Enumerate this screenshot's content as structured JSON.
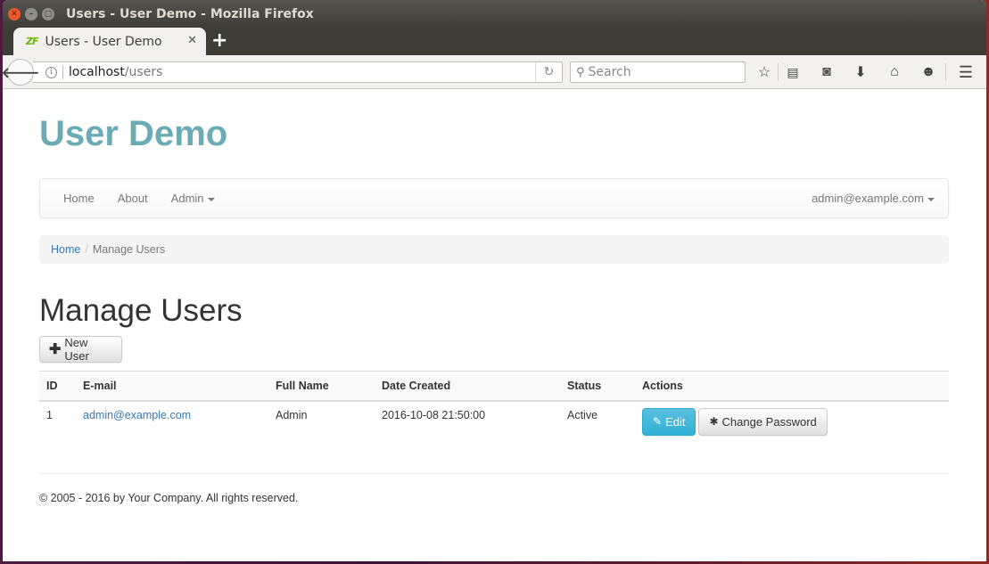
{
  "window": {
    "title": "Users - User Demo - Mozilla Firefox",
    "controls": [
      "close",
      "minimize",
      "maximize"
    ]
  },
  "browser": {
    "tab": {
      "title": "Users - User Demo",
      "favicon": "zf-icon",
      "favicon_text": "ZF"
    },
    "url": {
      "host": "localhost",
      "path": "/users"
    },
    "search_placeholder": "Search",
    "toolbar_icons": [
      "star-icon",
      "reading-list-icon",
      "pocket-icon",
      "download-icon",
      "home-icon",
      "hello-icon",
      "menu-icon"
    ]
  },
  "page": {
    "brand": "User Demo",
    "brand_color": "#6aabb4",
    "nav": {
      "items": [
        {
          "label": "Home"
        },
        {
          "label": "About"
        },
        {
          "label": "Admin",
          "dropdown": true
        }
      ],
      "user_menu": "admin@example.com"
    },
    "breadcrumb": {
      "items": [
        "Home",
        "Manage Users"
      ]
    },
    "heading": "Manage Users",
    "new_user_label": "New User",
    "table": {
      "columns": [
        "ID",
        "E-mail",
        "Full Name",
        "Date Created",
        "Status",
        "Actions"
      ],
      "rows": [
        {
          "id": "1",
          "email": "admin@example.com",
          "full_name": "Admin",
          "date_created": "2016-10-08 21:50:00",
          "status": "Active",
          "actions": {
            "edit": "Edit",
            "change_password": "Change Password"
          }
        }
      ]
    },
    "footer": "© 2005 - 2016 by Your Company. All rights reserved."
  }
}
